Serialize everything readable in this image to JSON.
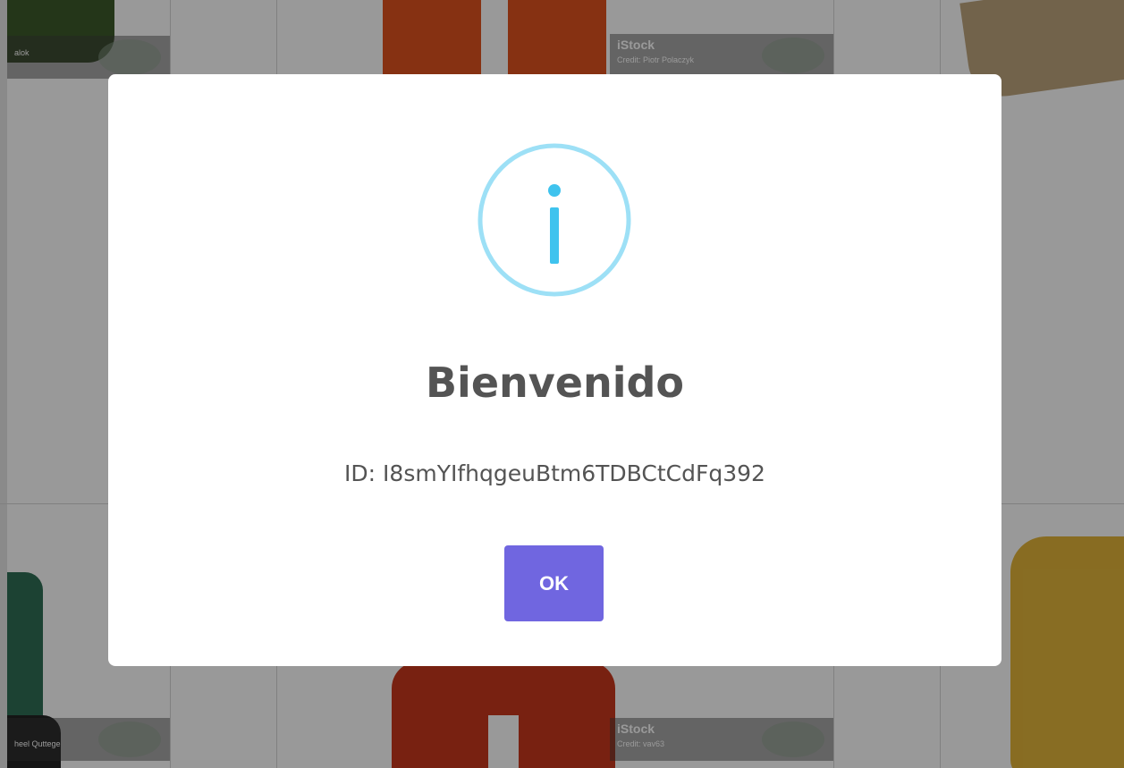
{
  "background": {
    "watermarks": [
      {
        "brand": "iStock",
        "credit": "Credit: Piotr Polaczyk"
      },
      {
        "brand": "iStock",
        "credit": "Credit: vav63"
      },
      {
        "brand": "",
        "credit": "alok"
      },
      {
        "brand": "",
        "credit": "heel Quttege"
      }
    ]
  },
  "modal": {
    "icon": "info-icon",
    "icon_color": "#87adbd",
    "title": "Bienvenido",
    "text": "ID: I8smYIfhqgeuBtm6TDBCtCdFq392",
    "ok_label": "OK",
    "button_color": "#7066e0"
  }
}
